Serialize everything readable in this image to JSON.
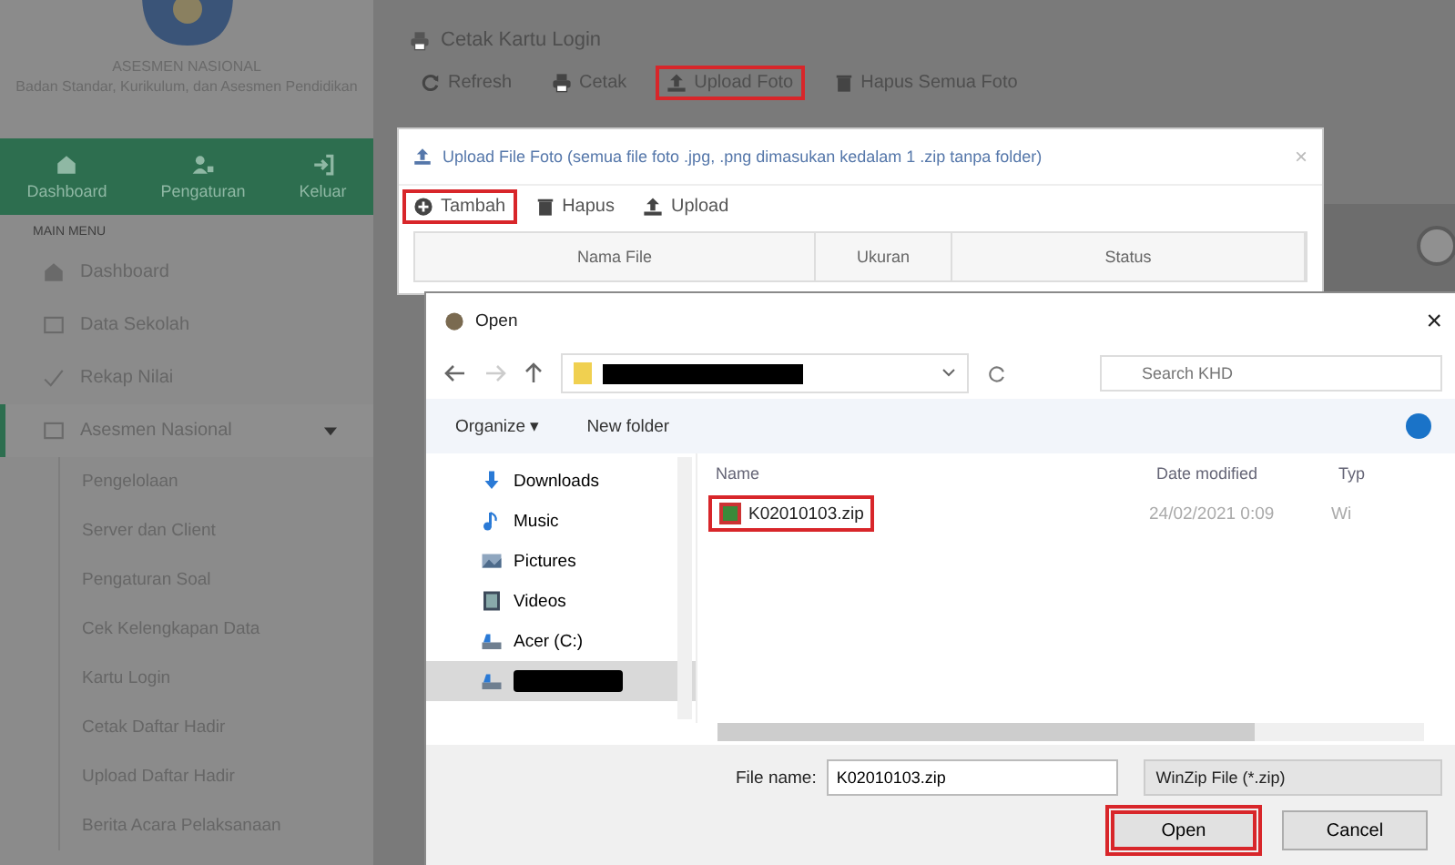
{
  "sidebar": {
    "org_title": "ASESMEN NASIONAL",
    "org_subtitle": "Badan Standar, Kurikulum, dan Asesmen Pendidikan",
    "top_nav": [
      {
        "label": "Dashboard"
      },
      {
        "label": "Pengaturan"
      },
      {
        "label": "Keluar"
      }
    ],
    "section_label": "MAIN MENU",
    "menu": [
      {
        "label": "Dashboard",
        "selected": false
      },
      {
        "label": "Data Sekolah",
        "selected": false
      },
      {
        "label": "Rekap Nilai",
        "selected": false
      },
      {
        "label": "Asesmen Nasional",
        "selected": true,
        "expanded": true,
        "children": [
          {
            "label": "Pengelolaan"
          },
          {
            "label": "Server dan Client"
          },
          {
            "label": "Pengaturan Soal"
          },
          {
            "label": "Cek Kelengkapan Data"
          },
          {
            "label": "Kartu Login"
          },
          {
            "label": "Cetak Daftar Hadir"
          },
          {
            "label": "Upload Daftar Hadir"
          },
          {
            "label": "Berita Acara Pelaksanaan"
          }
        ]
      }
    ]
  },
  "page": {
    "title": "Cetak Kartu Login",
    "toolbar": [
      {
        "label": "Refresh",
        "highlighted": false
      },
      {
        "label": "Cetak",
        "highlighted": false
      },
      {
        "label": "Upload Foto",
        "highlighted": true
      },
      {
        "label": "Hapus Semua Foto",
        "highlighted": false
      }
    ]
  },
  "upload_dialog": {
    "title": "Upload File Foto (semua file foto .jpg, .png dimasukan kedalam 1 .zip tanpa folder)",
    "close": "×",
    "toolbar": [
      {
        "label": "Tambah",
        "highlighted": true
      },
      {
        "label": "Hapus",
        "highlighted": false
      },
      {
        "label": "Upload",
        "highlighted": false
      }
    ],
    "columns": [
      "Nama File",
      "Ukuran",
      "Status"
    ]
  },
  "open_dialog": {
    "title": "Open",
    "close": "×",
    "search": {
      "placeholder": "Search KHD"
    },
    "commands": [
      {
        "label": "Organize ▾"
      },
      {
        "label": "New folder"
      }
    ],
    "nav": [
      {
        "label": "Downloads",
        "selected": false
      },
      {
        "label": "Music",
        "selected": false
      },
      {
        "label": "Pictures",
        "selected": false
      },
      {
        "label": "Videos",
        "selected": false
      },
      {
        "label": "Acer (C:)",
        "selected": false
      },
      {
        "selected": true,
        "redacted": true
      }
    ],
    "columns": [
      "Name",
      "Date modified",
      "Typ"
    ],
    "files": [
      {
        "name": "K02010103.zip",
        "date": "24/02/2021 0:09",
        "type": "Wi",
        "highlighted": true
      }
    ],
    "file_name_label": "File name:",
    "file_name": "K02010103.zip",
    "filter": "WinZip File (*.zip)",
    "buttons": [
      {
        "label": "Open",
        "kind": "primary",
        "highlighted": true
      },
      {
        "label": "Cancel",
        "kind": "secondary",
        "highlighted": false
      }
    ]
  }
}
